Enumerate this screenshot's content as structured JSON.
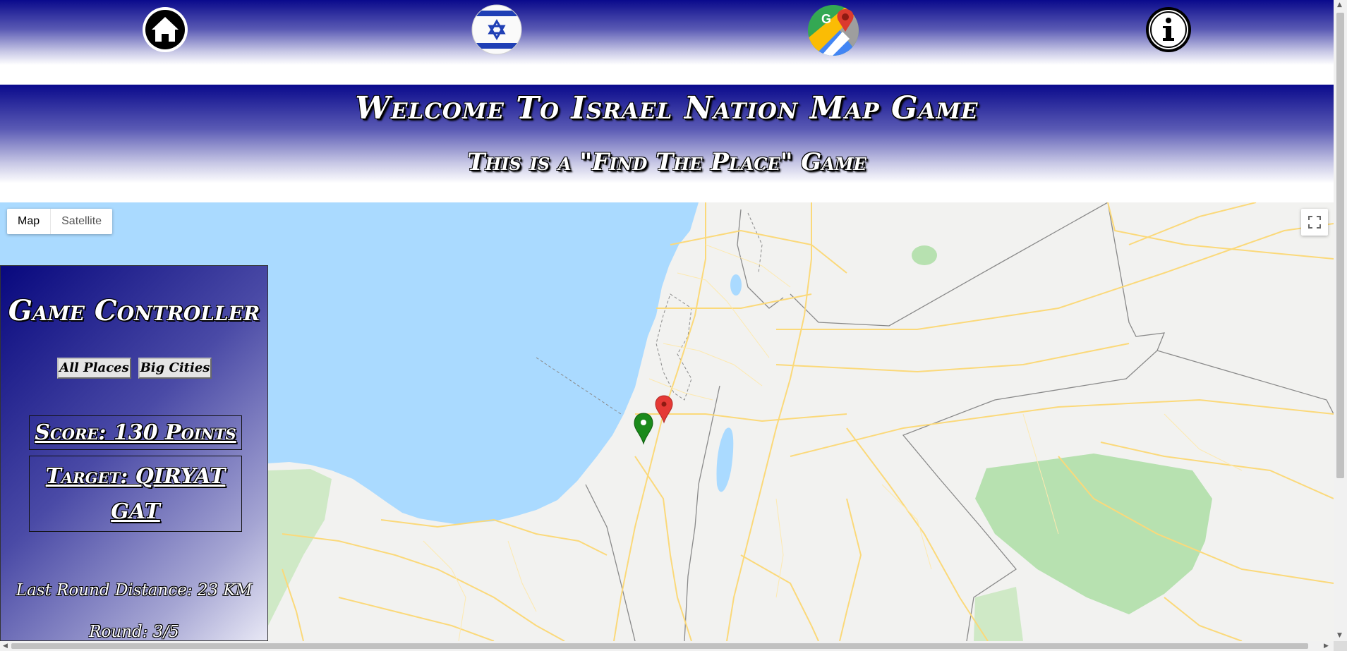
{
  "nav": {
    "items": [
      {
        "name": "home",
        "icon": "home-icon"
      },
      {
        "name": "israel-flag",
        "icon": "israel-flag-icon"
      },
      {
        "name": "google-maps",
        "icon": "google-maps-icon"
      },
      {
        "name": "info",
        "icon": "info-icon"
      }
    ]
  },
  "header": {
    "title": "Welcome To Israel Nation Map Game",
    "subtitle": "This is a \"Find The Place\" Game"
  },
  "map": {
    "type_options": [
      "Map",
      "Satellite"
    ],
    "selected_type": "Map",
    "fullscreen_icon": "fullscreen-icon",
    "markers": [
      {
        "color": "#e53935",
        "icon": "red-map-pin-icon"
      },
      {
        "color": "#1b8a1b",
        "icon": "green-map-pin-icon"
      }
    ],
    "colors": {
      "sea": "#aadaff",
      "land": "#f2f2f0",
      "parks": "#b7e1b0",
      "roads": "#fbd97a"
    }
  },
  "controller": {
    "title": "Game Controller",
    "buttons": {
      "all_places": "All Places",
      "big_cities": "Big Cities"
    },
    "score": "Score: 130 Points",
    "target": "Target: QIRYAT GAT",
    "last_round_distance": "Last Round Distance: 23 KM",
    "round": "Round: 3/5"
  },
  "colors": {
    "header_gradient_top": "#0a0a8c",
    "header_gradient_bottom": "#ffffff"
  }
}
